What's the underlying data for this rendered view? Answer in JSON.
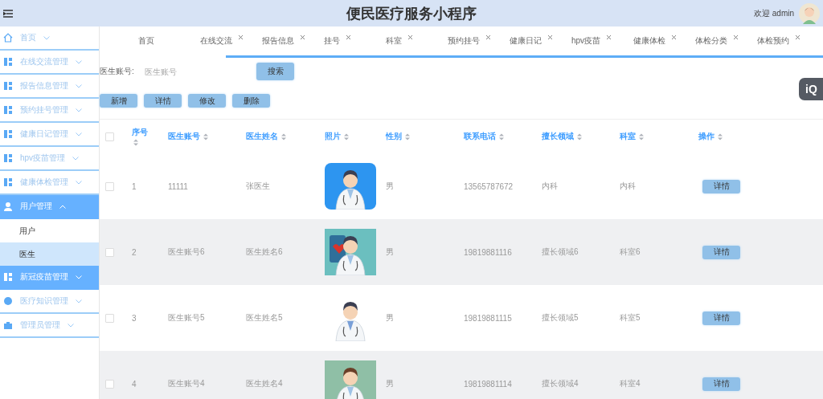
{
  "header": {
    "title": "便民医疗服务小程序",
    "welcome": "欢迎 admin"
  },
  "sidebar": {
    "items": [
      {
        "label": "首页",
        "expanded": false,
        "highlighted": false
      },
      {
        "label": "在线交流管理",
        "expanded": false,
        "highlighted": false
      },
      {
        "label": "报告信息管理",
        "expanded": false,
        "highlighted": false
      },
      {
        "label": "预约挂号管理",
        "expanded": false,
        "highlighted": false
      },
      {
        "label": "健康日记管理",
        "expanded": false,
        "highlighted": false
      },
      {
        "label": "hpv疫苗管理",
        "expanded": false,
        "highlighted": false
      },
      {
        "label": "健康体检管理",
        "expanded": false,
        "highlighted": false
      },
      {
        "label": "用户管理",
        "expanded": true,
        "highlighted": true,
        "children": [
          {
            "label": "用户",
            "selected": false
          },
          {
            "label": "医生",
            "selected": true
          }
        ]
      },
      {
        "label": "新冠疫苗管理",
        "expanded": false,
        "highlighted": true
      },
      {
        "label": "医疗知识管理",
        "expanded": false,
        "highlighted": false
      },
      {
        "label": "管理员管理",
        "expanded": false,
        "highlighted": false
      }
    ]
  },
  "tabs": [
    {
      "label": "首页",
      "closable": false
    },
    {
      "label": "在线交流",
      "closable": true
    },
    {
      "label": "报告信息",
      "closable": true
    },
    {
      "label": "挂号",
      "closable": true
    },
    {
      "label": "科室",
      "closable": true
    },
    {
      "label": "预约挂号",
      "closable": true
    },
    {
      "label": "健康日记",
      "closable": true
    },
    {
      "label": "hpv疫苗",
      "closable": true
    },
    {
      "label": "健康体检",
      "closable": true
    },
    {
      "label": "体检分类",
      "closable": true
    },
    {
      "label": "体检预约",
      "closable": true
    }
  ],
  "search": {
    "label": "医生账号:",
    "placeholder": "医生账号",
    "button": "搜索"
  },
  "actions": [
    "新增",
    "详情",
    "修改",
    "删除"
  ],
  "floating_badge": "iQ",
  "table": {
    "select_all_checked": false,
    "columns": [
      "序号",
      "医生账号",
      "医生姓名",
      "照片",
      "性别",
      "联系电话",
      "擅长领域",
      "科室",
      "操作"
    ],
    "rows": [
      {
        "checked": false,
        "cells": [
          "1",
          "11111",
          "张医生"
        ],
        "sex": "男",
        "phone": "13565787672",
        "field": "内科",
        "dept": "内科",
        "action": "详情"
      },
      {
        "checked": false,
        "cells": [
          "2",
          "医生账号6",
          "医生姓名6"
        ],
        "sex": "男",
        "phone": "19819881116",
        "field": "擅长领域6",
        "dept": "科室6",
        "action": "详情"
      },
      {
        "checked": false,
        "cells": [
          "3",
          "医生账号5",
          "医生姓名5"
        ],
        "sex": "男",
        "phone": "19819881115",
        "field": "擅长领域5",
        "dept": "科室5",
        "action": "详情"
      },
      {
        "checked": false,
        "cells": [
          "4",
          "医生账号4",
          "医生姓名4"
        ],
        "sex": "男",
        "phone": "19819881114",
        "field": "擅长领域4",
        "dept": "科室4",
        "action": "详情"
      }
    ]
  }
}
